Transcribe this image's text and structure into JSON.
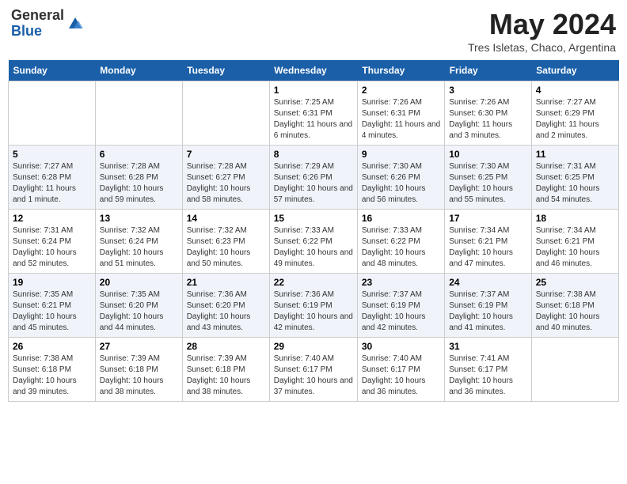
{
  "header": {
    "logo_general": "General",
    "logo_blue": "Blue",
    "month": "May 2024",
    "location": "Tres Isletas, Chaco, Argentina"
  },
  "weekdays": [
    "Sunday",
    "Monday",
    "Tuesday",
    "Wednesday",
    "Thursday",
    "Friday",
    "Saturday"
  ],
  "weeks": [
    [
      {
        "day": "",
        "info": ""
      },
      {
        "day": "",
        "info": ""
      },
      {
        "day": "",
        "info": ""
      },
      {
        "day": "1",
        "sunrise": "Sunrise: 7:25 AM",
        "sunset": "Sunset: 6:31 PM",
        "daylight": "Daylight: 11 hours and 6 minutes."
      },
      {
        "day": "2",
        "sunrise": "Sunrise: 7:26 AM",
        "sunset": "Sunset: 6:31 PM",
        "daylight": "Daylight: 11 hours and 4 minutes."
      },
      {
        "day": "3",
        "sunrise": "Sunrise: 7:26 AM",
        "sunset": "Sunset: 6:30 PM",
        "daylight": "Daylight: 11 hours and 3 minutes."
      },
      {
        "day": "4",
        "sunrise": "Sunrise: 7:27 AM",
        "sunset": "Sunset: 6:29 PM",
        "daylight": "Daylight: 11 hours and 2 minutes."
      }
    ],
    [
      {
        "day": "5",
        "sunrise": "Sunrise: 7:27 AM",
        "sunset": "Sunset: 6:28 PM",
        "daylight": "Daylight: 11 hours and 1 minute."
      },
      {
        "day": "6",
        "sunrise": "Sunrise: 7:28 AM",
        "sunset": "Sunset: 6:28 PM",
        "daylight": "Daylight: 10 hours and 59 minutes."
      },
      {
        "day": "7",
        "sunrise": "Sunrise: 7:28 AM",
        "sunset": "Sunset: 6:27 PM",
        "daylight": "Daylight: 10 hours and 58 minutes."
      },
      {
        "day": "8",
        "sunrise": "Sunrise: 7:29 AM",
        "sunset": "Sunset: 6:26 PM",
        "daylight": "Daylight: 10 hours and 57 minutes."
      },
      {
        "day": "9",
        "sunrise": "Sunrise: 7:30 AM",
        "sunset": "Sunset: 6:26 PM",
        "daylight": "Daylight: 10 hours and 56 minutes."
      },
      {
        "day": "10",
        "sunrise": "Sunrise: 7:30 AM",
        "sunset": "Sunset: 6:25 PM",
        "daylight": "Daylight: 10 hours and 55 minutes."
      },
      {
        "day": "11",
        "sunrise": "Sunrise: 7:31 AM",
        "sunset": "Sunset: 6:25 PM",
        "daylight": "Daylight: 10 hours and 54 minutes."
      }
    ],
    [
      {
        "day": "12",
        "sunrise": "Sunrise: 7:31 AM",
        "sunset": "Sunset: 6:24 PM",
        "daylight": "Daylight: 10 hours and 52 minutes."
      },
      {
        "day": "13",
        "sunrise": "Sunrise: 7:32 AM",
        "sunset": "Sunset: 6:24 PM",
        "daylight": "Daylight: 10 hours and 51 minutes."
      },
      {
        "day": "14",
        "sunrise": "Sunrise: 7:32 AM",
        "sunset": "Sunset: 6:23 PM",
        "daylight": "Daylight: 10 hours and 50 minutes."
      },
      {
        "day": "15",
        "sunrise": "Sunrise: 7:33 AM",
        "sunset": "Sunset: 6:22 PM",
        "daylight": "Daylight: 10 hours and 49 minutes."
      },
      {
        "day": "16",
        "sunrise": "Sunrise: 7:33 AM",
        "sunset": "Sunset: 6:22 PM",
        "daylight": "Daylight: 10 hours and 48 minutes."
      },
      {
        "day": "17",
        "sunrise": "Sunrise: 7:34 AM",
        "sunset": "Sunset: 6:21 PM",
        "daylight": "Daylight: 10 hours and 47 minutes."
      },
      {
        "day": "18",
        "sunrise": "Sunrise: 7:34 AM",
        "sunset": "Sunset: 6:21 PM",
        "daylight": "Daylight: 10 hours and 46 minutes."
      }
    ],
    [
      {
        "day": "19",
        "sunrise": "Sunrise: 7:35 AM",
        "sunset": "Sunset: 6:21 PM",
        "daylight": "Daylight: 10 hours and 45 minutes."
      },
      {
        "day": "20",
        "sunrise": "Sunrise: 7:35 AM",
        "sunset": "Sunset: 6:20 PM",
        "daylight": "Daylight: 10 hours and 44 minutes."
      },
      {
        "day": "21",
        "sunrise": "Sunrise: 7:36 AM",
        "sunset": "Sunset: 6:20 PM",
        "daylight": "Daylight: 10 hours and 43 minutes."
      },
      {
        "day": "22",
        "sunrise": "Sunrise: 7:36 AM",
        "sunset": "Sunset: 6:19 PM",
        "daylight": "Daylight: 10 hours and 42 minutes."
      },
      {
        "day": "23",
        "sunrise": "Sunrise: 7:37 AM",
        "sunset": "Sunset: 6:19 PM",
        "daylight": "Daylight: 10 hours and 42 minutes."
      },
      {
        "day": "24",
        "sunrise": "Sunrise: 7:37 AM",
        "sunset": "Sunset: 6:19 PM",
        "daylight": "Daylight: 10 hours and 41 minutes."
      },
      {
        "day": "25",
        "sunrise": "Sunrise: 7:38 AM",
        "sunset": "Sunset: 6:18 PM",
        "daylight": "Daylight: 10 hours and 40 minutes."
      }
    ],
    [
      {
        "day": "26",
        "sunrise": "Sunrise: 7:38 AM",
        "sunset": "Sunset: 6:18 PM",
        "daylight": "Daylight: 10 hours and 39 minutes."
      },
      {
        "day": "27",
        "sunrise": "Sunrise: 7:39 AM",
        "sunset": "Sunset: 6:18 PM",
        "daylight": "Daylight: 10 hours and 38 minutes."
      },
      {
        "day": "28",
        "sunrise": "Sunrise: 7:39 AM",
        "sunset": "Sunset: 6:18 PM",
        "daylight": "Daylight: 10 hours and 38 minutes."
      },
      {
        "day": "29",
        "sunrise": "Sunrise: 7:40 AM",
        "sunset": "Sunset: 6:17 PM",
        "daylight": "Daylight: 10 hours and 37 minutes."
      },
      {
        "day": "30",
        "sunrise": "Sunrise: 7:40 AM",
        "sunset": "Sunset: 6:17 PM",
        "daylight": "Daylight: 10 hours and 36 minutes."
      },
      {
        "day": "31",
        "sunrise": "Sunrise: 7:41 AM",
        "sunset": "Sunset: 6:17 PM",
        "daylight": "Daylight: 10 hours and 36 minutes."
      },
      {
        "day": "",
        "info": ""
      }
    ]
  ]
}
